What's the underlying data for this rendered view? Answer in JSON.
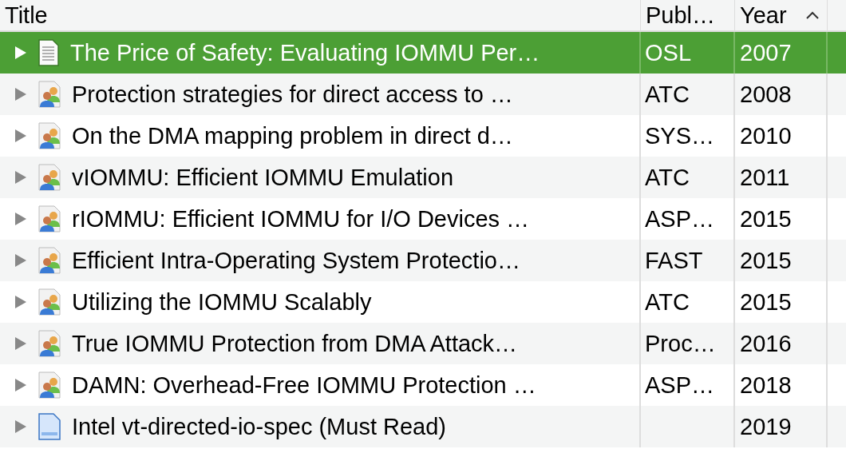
{
  "columns": [
    {
      "label": "Title",
      "sorted": false
    },
    {
      "label": "Publ…",
      "sorted": false
    },
    {
      "label": "Year",
      "sorted": true
    }
  ],
  "rows": [
    {
      "kind": "document",
      "title": "The Price of Safety: Evaluating IOMMU Per…",
      "publication": "OSL",
      "year": "2007",
      "selected": true
    },
    {
      "kind": "conference",
      "title": "Protection strategies for direct access to …",
      "publication": "ATC",
      "year": "2008",
      "selected": false
    },
    {
      "kind": "conference",
      "title": "On the DMA mapping problem in direct d…",
      "publication": "SYS…",
      "year": "2010",
      "selected": false
    },
    {
      "kind": "conference",
      "title": "vIOMMU: Efficient IOMMU Emulation",
      "publication": "ATC",
      "year": "2011",
      "selected": false
    },
    {
      "kind": "conference",
      "title": "rIOMMU: Efficient IOMMU for I/O Devices …",
      "publication": "ASP…",
      "year": "2015",
      "selected": false
    },
    {
      "kind": "conference",
      "title": "Efficient Intra-Operating System Protectio…",
      "publication": "FAST",
      "year": "2015",
      "selected": false
    },
    {
      "kind": "conference",
      "title": "Utilizing the IOMMU Scalably",
      "publication": "ATC",
      "year": "2015",
      "selected": false
    },
    {
      "kind": "conference",
      "title": "True IOMMU Protection from DMA Attack…",
      "publication": "Proc…",
      "year": "2016",
      "selected": false
    },
    {
      "kind": "conference",
      "title": "DAMN: Overhead-Free IOMMU Protection …",
      "publication": "ASP…",
      "year": "2018",
      "selected": false
    },
    {
      "kind": "webpage",
      "title": "Intel vt-directed-io-spec (Must Read)",
      "year": "2019",
      "selected": false
    }
  ]
}
